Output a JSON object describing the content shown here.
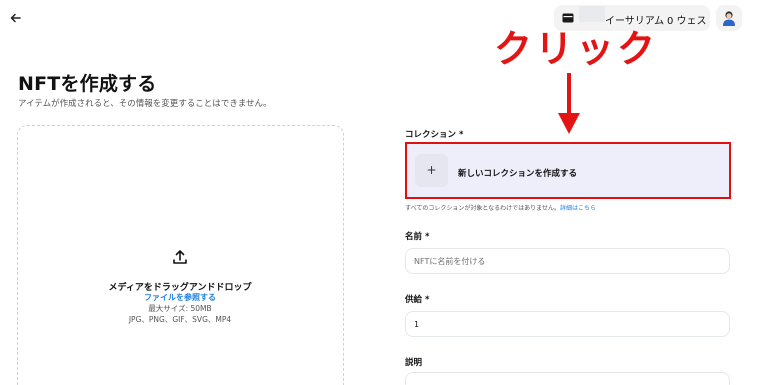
{
  "header": {
    "back_icon": "arrow-left-icon",
    "wallet": {
      "icon": "wallet-icon",
      "currency_label": "イーサリアム",
      "balance": "0 ウェス"
    },
    "avatar_icon": "user-avatar-icon"
  },
  "page": {
    "title": "NFTを作成する",
    "subtitle": "アイテムが作成されると、その情報を変更することはできません。"
  },
  "media": {
    "upload_icon": "upload-icon",
    "title": "メディアをドラッグアンドドロップ",
    "browse_link": "ファイルを参照する",
    "max_size": "最大サイズ: 50MB",
    "file_types": "JPG、PNG、GIF、SVG、MP4"
  },
  "form": {
    "collection": {
      "label": "コレクション *",
      "create_button_icon": "+",
      "create_button_label": "新しいコレクションを作成する",
      "note": "すべてのコレクションが対象となるわけではありません。",
      "note_link": "詳細はこちら"
    },
    "name": {
      "label": "名前 *",
      "placeholder": "NFTに名前を付ける",
      "value": ""
    },
    "supply": {
      "label": "供給 *",
      "value": "1"
    },
    "description": {
      "label": "説明"
    }
  },
  "annotation": {
    "text": "クリック",
    "color": "#e41414"
  },
  "colors": {
    "accent_link": "#2081e2",
    "highlight_border": "#e01010",
    "collection_bg": "#eeeefa"
  }
}
